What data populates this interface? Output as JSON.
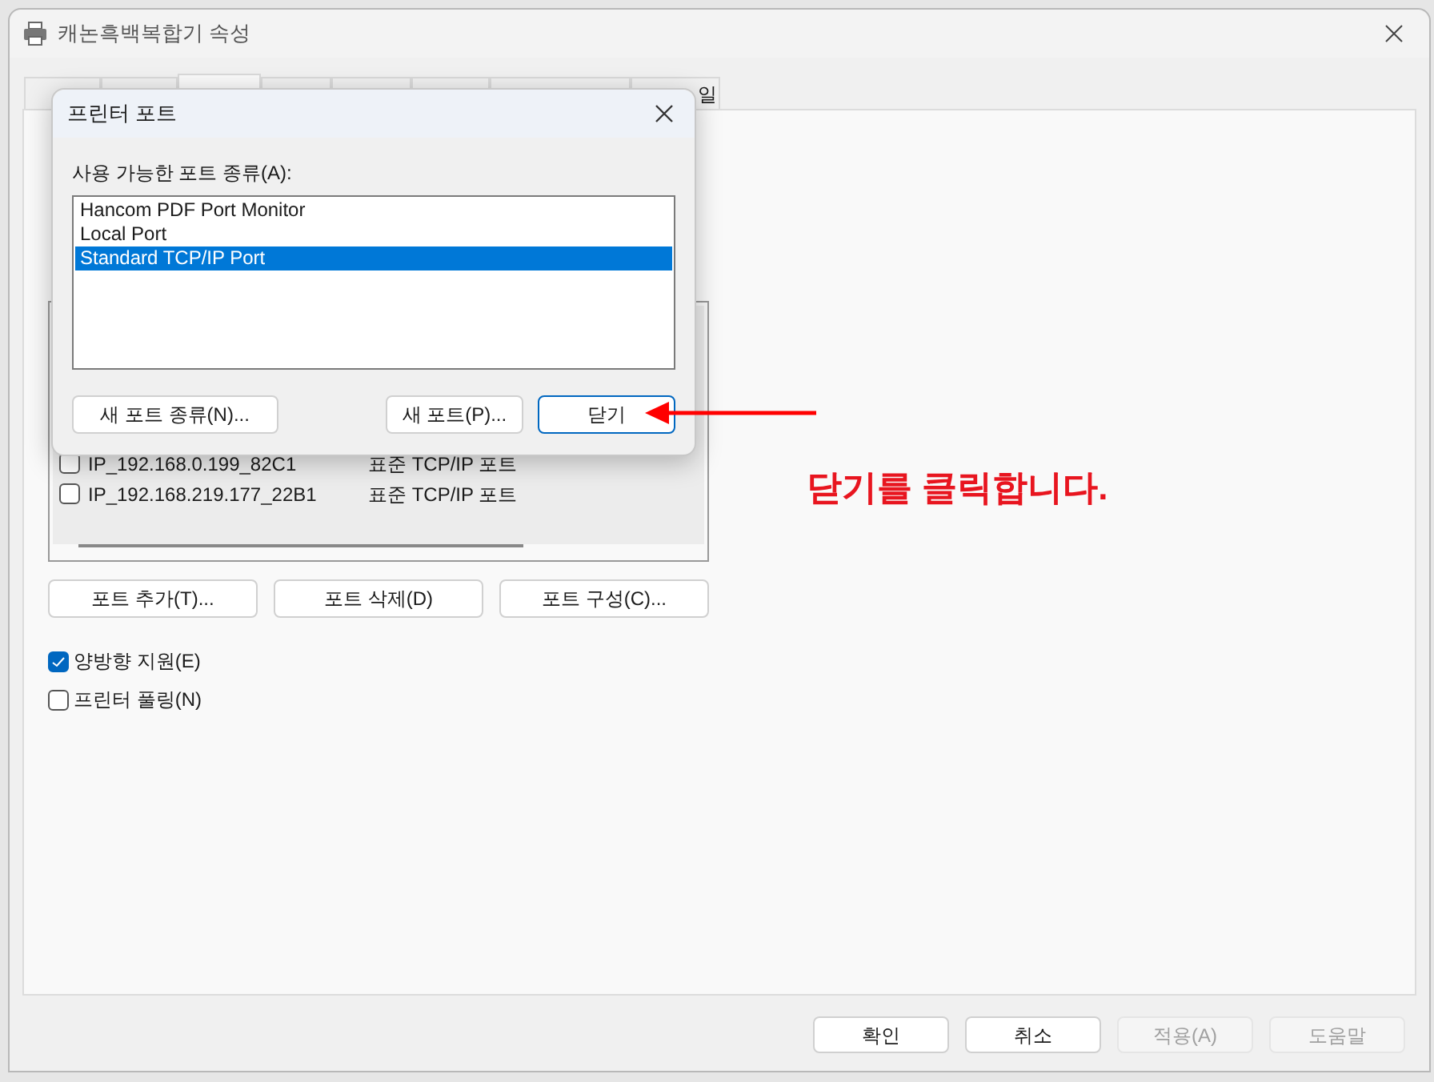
{
  "window": {
    "title": "캐논흑백복합기 속성"
  },
  "tabs": [
    {
      "selected": false
    },
    {
      "selected": false
    },
    {
      "selected": true
    },
    {
      "selected": false
    },
    {
      "selected": false
    },
    {
      "selected": false
    },
    {
      "selected": false
    },
    {
      "label": "일",
      "selected": false
    }
  ],
  "ports": [
    {
      "name": "IP_192.168.0.199_82C1",
      "description": "표준 TCP/IP 포트",
      "checked": false
    },
    {
      "name": "IP_192.168.219.177_22B1",
      "description": "표준 TCP/IP 포트",
      "checked": false
    }
  ],
  "port_buttons": [
    "포트 추가(T)...",
    "포트 삭제(D)",
    "포트 구성(C)..."
  ],
  "options": [
    {
      "label": "양방향 지원(E)",
      "checked": true
    },
    {
      "label": "프린터 풀링(N)",
      "checked": false
    }
  ],
  "footer_buttons": [
    {
      "label": "확인",
      "disabled": false
    },
    {
      "label": "취소",
      "disabled": false
    },
    {
      "label": "적용(A)",
      "disabled": true
    },
    {
      "label": "도움말",
      "disabled": true
    }
  ],
  "dialog": {
    "title": "프린터 포트",
    "list_label": "사용 가능한 포트 종류(A):",
    "port_types": [
      {
        "label": "Hancom PDF Port Monitor",
        "selected": false
      },
      {
        "label": "Local Port",
        "selected": false
      },
      {
        "label": "Standard TCP/IP Port",
        "selected": true
      }
    ],
    "buttons": [
      {
        "label": "새 포트 종류(N)...",
        "default": false
      },
      {
        "label": "새 포트(P)...",
        "default": false
      },
      {
        "label": "닫기",
        "default": true
      }
    ]
  },
  "annotation": {
    "text": "닫기를 클릭합니다."
  }
}
